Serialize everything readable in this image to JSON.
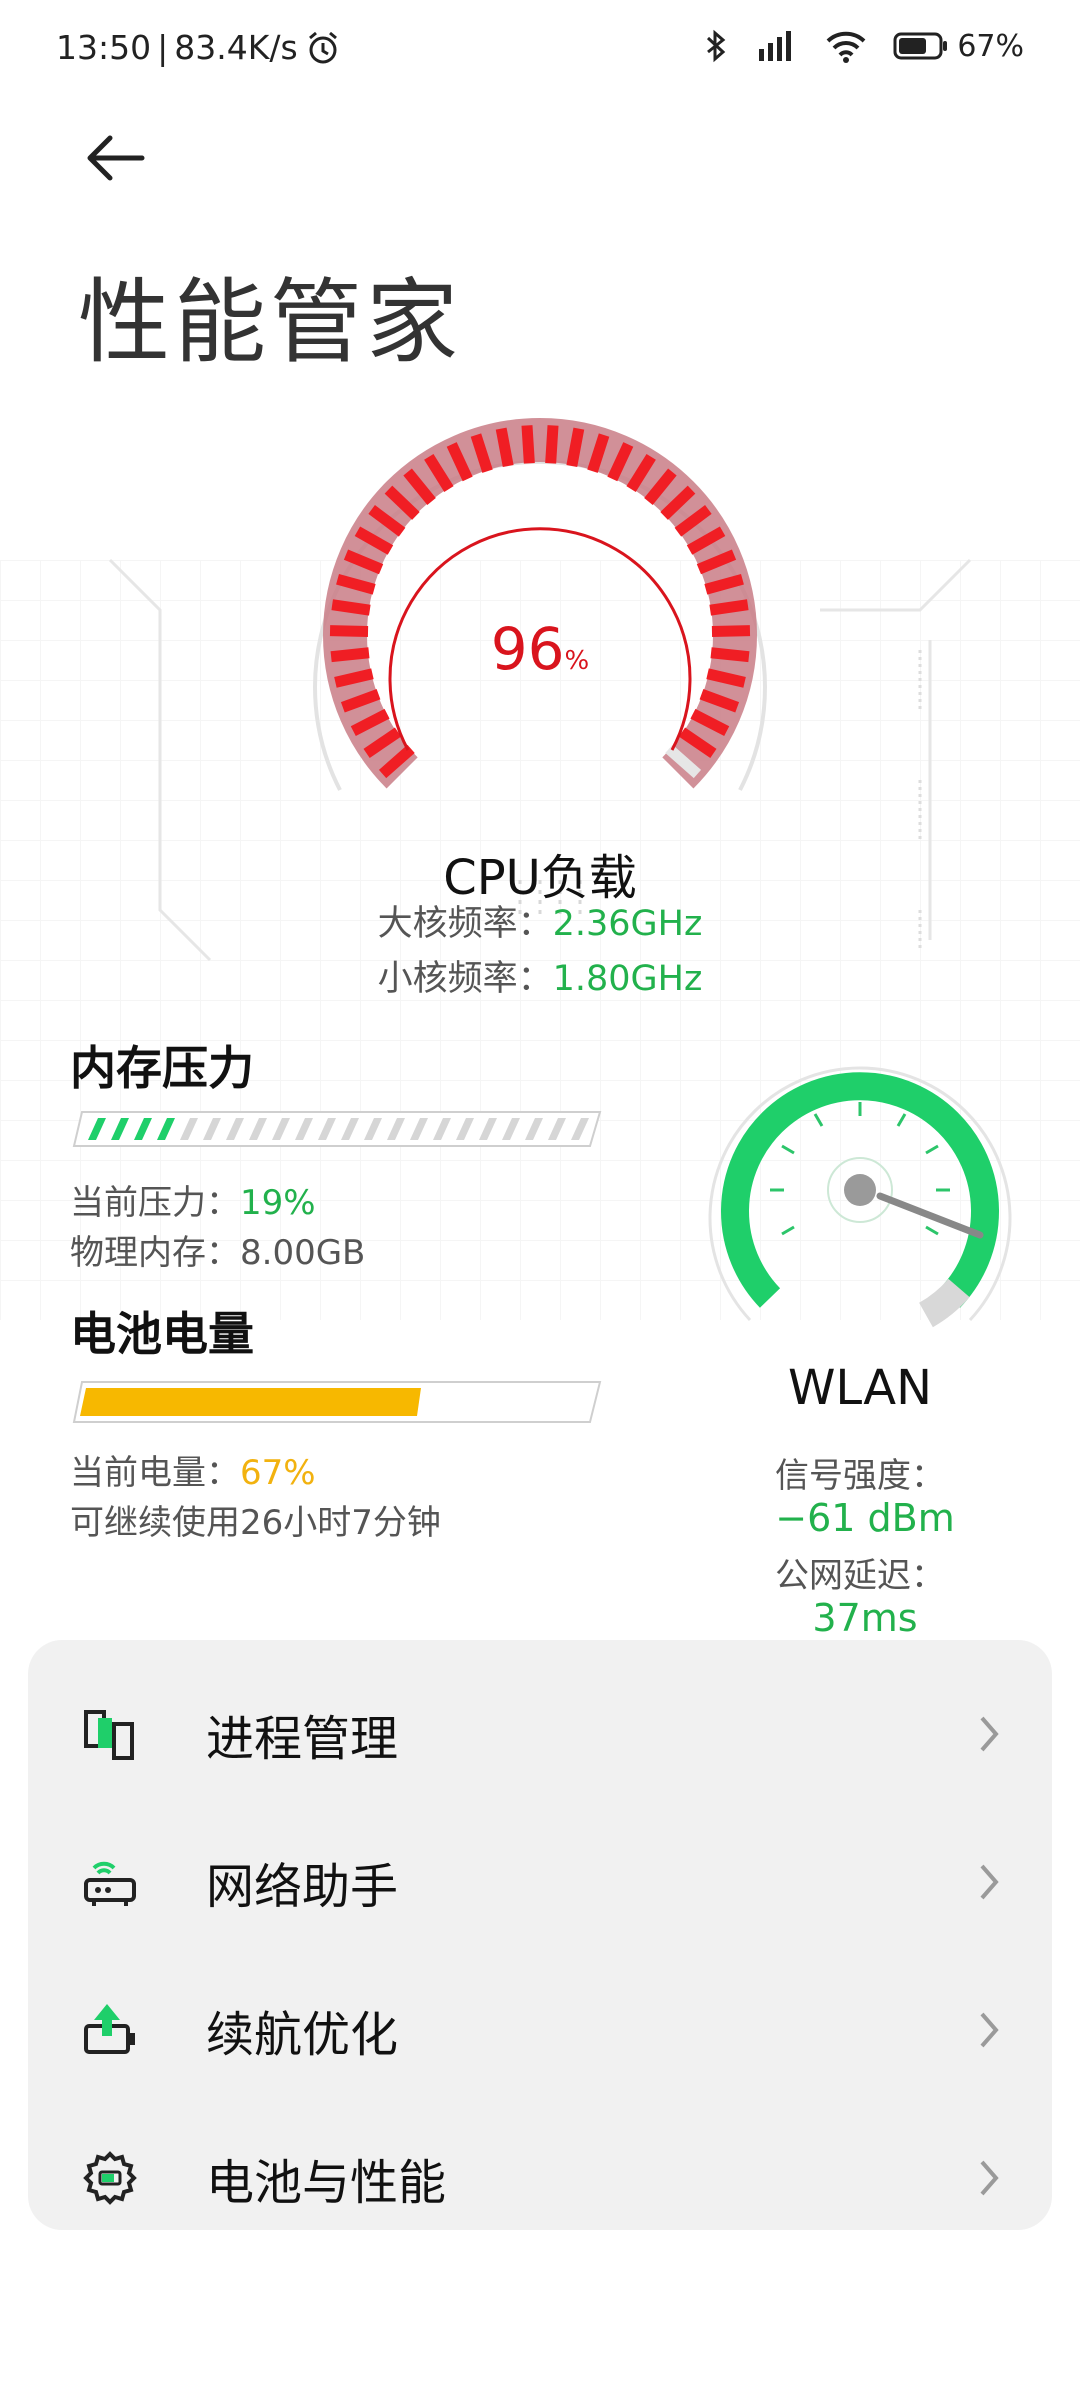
{
  "status_bar": {
    "time": "13:50",
    "net_speed": "83.4K/s",
    "battery": "67%"
  },
  "header": {
    "title": "性能管家"
  },
  "cpu": {
    "load_value": "96",
    "load_unit": "%",
    "label": "CPU负载",
    "big_core_label": "大核频率：",
    "big_core_value": "2.36GHz",
    "small_core_label": "小核频率：",
    "small_core_value": "1.80GHz",
    "load_fraction": 0.96
  },
  "memory": {
    "title": "内存压力",
    "pressure_label": "当前压力：",
    "pressure_value": "19%",
    "physical_label": "物理内存：",
    "physical_value": "8.00GB",
    "pressure_fraction": 0.19
  },
  "battery": {
    "title": "电池电量",
    "level_label": "当前电量：",
    "level_value": "67%",
    "remaining": "可继续使用26小时7分钟",
    "level_fraction": 0.67
  },
  "wlan": {
    "label": "WLAN",
    "signal_label": "信号强度：",
    "signal_value": "−61 dBm",
    "latency_label": "公网延迟：",
    "latency_value": "37ms"
  },
  "menu": {
    "items": [
      {
        "label": "进程管理",
        "icon": "process-icon"
      },
      {
        "label": "网络助手",
        "icon": "router-icon"
      },
      {
        "label": "续航优化",
        "icon": "battery-boost-icon"
      },
      {
        "label": "电池与性能",
        "icon": "gear-battery-icon"
      }
    ]
  },
  "colors": {
    "accent_green": "#22b14c",
    "accent_red": "#d9141d",
    "accent_yellow": "#f2b20f"
  }
}
